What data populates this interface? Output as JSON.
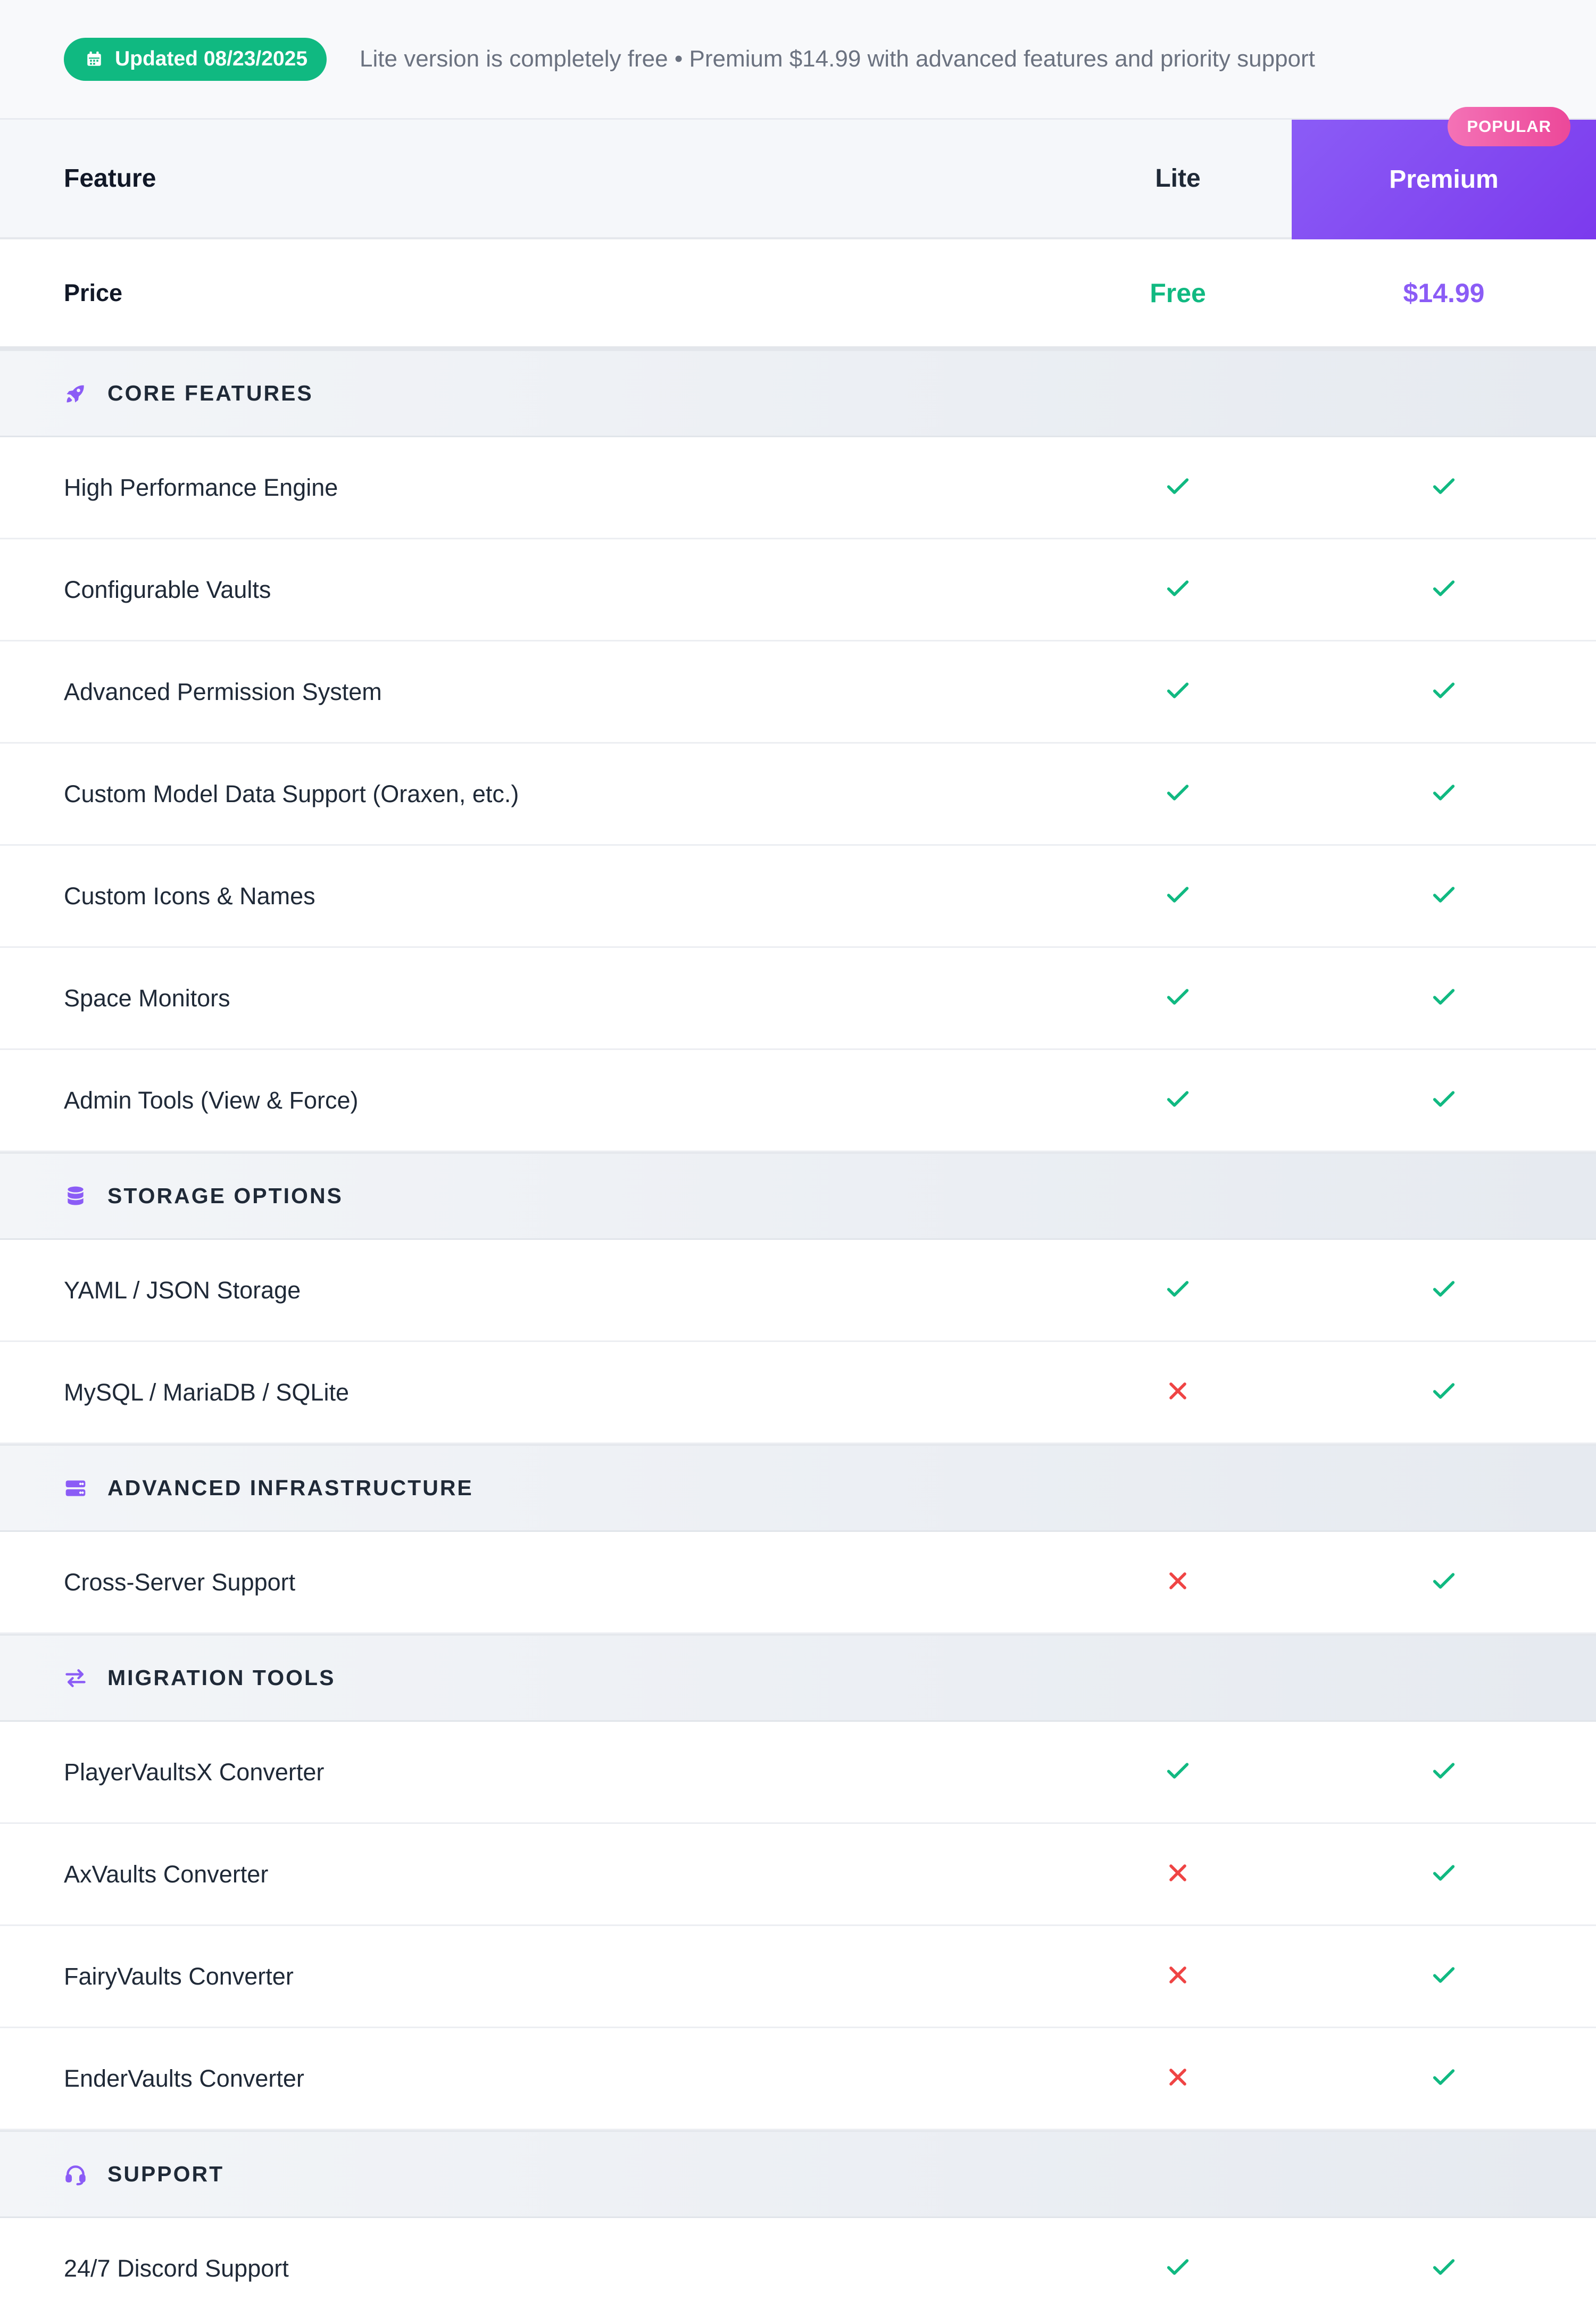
{
  "topbar": {
    "badge_label": "Updated 08/23/2025",
    "note": "Lite version is completely free • Premium $14.99 with advanced features and priority support"
  },
  "header": {
    "feature": "Feature",
    "lite": "Lite",
    "premium": "Premium",
    "popular": "POPULAR"
  },
  "price_row": {
    "label": "Price",
    "lite": "Free",
    "premium": "$14.99"
  },
  "colors": {
    "accent": "#8b5cf6",
    "check": "#10b981",
    "cross": "#ef4444",
    "popular": "#ec4899"
  },
  "sections": [
    {
      "title": "CORE FEATURES",
      "icon": "rocket-icon",
      "rows": [
        {
          "label": "High Performance Engine",
          "lite": true,
          "premium": true
        },
        {
          "label": "Configurable Vaults",
          "lite": true,
          "premium": true
        },
        {
          "label": "Advanced Permission System",
          "lite": true,
          "premium": true
        },
        {
          "label": "Custom Model Data Support (Oraxen, etc.)",
          "lite": true,
          "premium": true
        },
        {
          "label": "Custom Icons & Names",
          "lite": true,
          "premium": true
        },
        {
          "label": "Space Monitors",
          "lite": true,
          "premium": true
        },
        {
          "label": "Admin Tools (View & Force)",
          "lite": true,
          "premium": true
        }
      ]
    },
    {
      "title": "STORAGE OPTIONS",
      "icon": "database-icon",
      "rows": [
        {
          "label": "YAML / JSON Storage",
          "lite": true,
          "premium": true
        },
        {
          "label": "MySQL / MariaDB / SQLite",
          "lite": false,
          "premium": true
        }
      ]
    },
    {
      "title": "ADVANCED INFRASTRUCTURE",
      "icon": "server-icon",
      "rows": [
        {
          "label": "Cross-Server Support",
          "lite": false,
          "premium": true
        }
      ]
    },
    {
      "title": "MIGRATION TOOLS",
      "icon": "exchange-arrows-icon",
      "rows": [
        {
          "label": "PlayerVaultsX Converter",
          "lite": true,
          "premium": true
        },
        {
          "label": "AxVaults Converter",
          "lite": false,
          "premium": true
        },
        {
          "label": "FairyVaults Converter",
          "lite": false,
          "premium": true
        },
        {
          "label": "EnderVaults Converter",
          "lite": false,
          "premium": true
        }
      ]
    },
    {
      "title": "SUPPORT",
      "icon": "headset-icon",
      "rows": [
        {
          "label": "24/7 Discord Support",
          "lite": true,
          "premium": true
        }
      ]
    }
  ]
}
